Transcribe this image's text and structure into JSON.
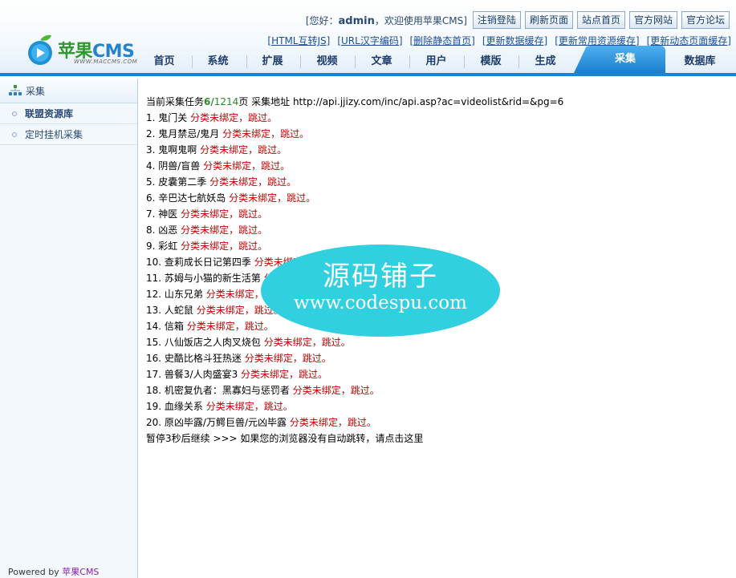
{
  "header": {
    "logo": {
      "brand_cn": "苹果",
      "brand_en": "CMS",
      "url": "WWW.MACCMS.COM"
    },
    "greeting": {
      "prefix": "[您好：",
      "user": "admin",
      "suffix": "，欢迎使用苹果CMS]"
    },
    "top_buttons": [
      "注销登陆",
      "刷新页面",
      "站点首页",
      "官方网站",
      "官方论坛"
    ],
    "links": [
      "[HTML互转JS]",
      "[URL汉字编码]",
      "[删除静态首页]",
      "[更新数据缓存]",
      "[更新常用资源缓存]",
      "[更新动态页面缓存]"
    ],
    "nav": [
      "首页",
      "系统",
      "扩展",
      "视频",
      "文章",
      "用户",
      "模版",
      "生成",
      "采集",
      "数据库"
    ],
    "nav_active": "采集"
  },
  "sidebar": {
    "title": "采集",
    "items": [
      "联盟资源库",
      "定时挂机采集"
    ],
    "active_index": 0,
    "powered": {
      "prefix": "Powered by ",
      "brand": "苹果CMS"
    }
  },
  "content": {
    "summary": {
      "prefix": "当前采集任务",
      "current": "6",
      "slash": "/",
      "total": "1214",
      "suffix": "页  采集地址 http://api.jjizy.com/inc/api.asp?ac=videolist&rid=&pg=6"
    },
    "skip_text": "分类未绑定，跳过。",
    "items": [
      "1. 鬼门关",
      "2. 鬼月禁忌/鬼月",
      "3. 鬼啊鬼啊",
      "4. 阴兽/盲兽",
      "5. 皮囊第二季",
      "6. 辛巴达七航妖岛",
      "7. 神医",
      "8. 凶恶",
      "9. 彩虹",
      "10. 查莉成长日记第四季",
      "11. 苏姆与小猫的新生活第",
      "12. 山东兄弟",
      "13. 人蛇鼠",
      "14. 信箱",
      "15. 八仙饭店之人肉叉烧包",
      "16. 史酷比格斗狂热迷",
      "17. 兽餐3/人肉盛宴3",
      "18. 机密复仇者：黑寡妇与惩罚者",
      "19. 血缘关系",
      "20. 原凶毕露/万鳄巨兽/元凶毕露"
    ],
    "footer": "暂停3秒后继续 >>> 如果您的浏览器没有自动跳转，请点击这里"
  },
  "watermark": {
    "title": "源码铺子",
    "url": "www.codespu.com"
  },
  "colors": {
    "accent": "#1d84d1",
    "skip": "#c00000",
    "count": "#2a8a2a",
    "watermark": "#30d0e0"
  }
}
